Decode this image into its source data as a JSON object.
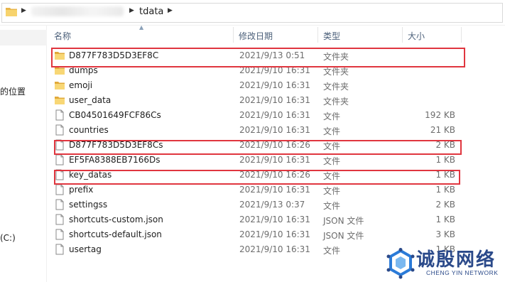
{
  "address": {
    "breadcrumb": "tdata"
  },
  "nav": {
    "items": [
      {
        "label": "的位置"
      },
      {
        "label": "(C:)"
      }
    ]
  },
  "columns": {
    "name": "名称",
    "date": "修改日期",
    "type": "类型",
    "size": "大小"
  },
  "files": [
    {
      "name": "D877F783D5D3EF8C",
      "date": "2021/9/13 0:51",
      "type": "文件夹",
      "size": "",
      "icon": "folder-icon"
    },
    {
      "name": "dumps",
      "date": "2021/9/10 16:31",
      "type": "文件夹",
      "size": "",
      "icon": "folder-icon"
    },
    {
      "name": "emoji",
      "date": "2021/9/10 16:31",
      "type": "文件夹",
      "size": "",
      "icon": "folder-icon"
    },
    {
      "name": "user_data",
      "date": "2021/9/10 16:31",
      "type": "文件夹",
      "size": "",
      "icon": "folder-icon"
    },
    {
      "name": "CB04501649FCF86Cs",
      "date": "2021/9/10 16:31",
      "type": "文件",
      "size": "192 KB",
      "icon": "file-icon"
    },
    {
      "name": "countries",
      "date": "2021/9/10 16:31",
      "type": "文件",
      "size": "21 KB",
      "icon": "file-icon"
    },
    {
      "name": "D877F783D5D3EF8Cs",
      "date": "2021/9/10 16:26",
      "type": "文件",
      "size": "2 KB",
      "icon": "file-icon"
    },
    {
      "name": "EF5FA8388EB7166Ds",
      "date": "2021/9/10 16:31",
      "type": "文件",
      "size": "1 KB",
      "icon": "file-icon"
    },
    {
      "name": "key_datas",
      "date": "2021/9/10 16:26",
      "type": "文件",
      "size": "1 KB",
      "icon": "file-icon"
    },
    {
      "name": "prefix",
      "date": "2021/9/10 16:31",
      "type": "文件",
      "size": "1 KB",
      "icon": "file-icon"
    },
    {
      "name": "settingss",
      "date": "2021/9/13 0:37",
      "type": "文件",
      "size": "2 KB",
      "icon": "file-icon"
    },
    {
      "name": "shortcuts-custom.json",
      "date": "2021/9/10 16:31",
      "type": "JSON 文件",
      "size": "1 KB",
      "icon": "file-icon"
    },
    {
      "name": "shortcuts-default.json",
      "date": "2021/9/10 16:31",
      "type": "JSON 文件",
      "size": "3 KB",
      "icon": "file-icon"
    },
    {
      "name": "usertag",
      "date": "2021/9/10 16:31",
      "type": "文件",
      "size": "1 KB",
      "icon": "file-icon"
    }
  ],
  "highlight_color": "#e0363f",
  "watermark": {
    "title": "诚殷网络",
    "subtitle": "CHENG YIN NETWORK"
  }
}
